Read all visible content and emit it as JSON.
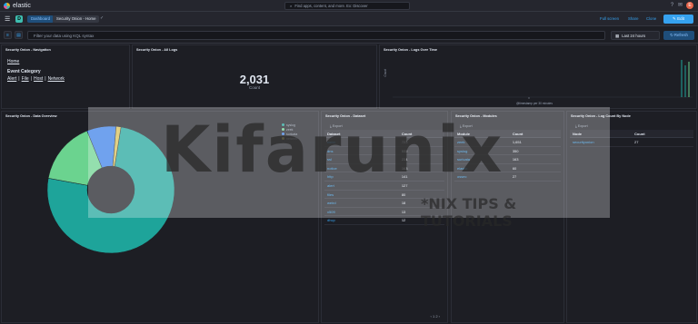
{
  "topbar": {
    "logo_text": "elastic",
    "search_placeholder": "Find apps, content, and more. Ex: Discover",
    "avatar_initial": "E"
  },
  "navbar": {
    "space_initial": "D",
    "breadcrumbs": [
      "Dashboard",
      "Security Onion - Home"
    ],
    "links": [
      "Full screen",
      "Share",
      "Clone"
    ],
    "edit_label": "Edit"
  },
  "querybar": {
    "placeholder": "Filter your data using KQL syntax",
    "date_label": "Last 24 hours",
    "refresh_label": "Refresh"
  },
  "panels": {
    "navigation": {
      "title": "Security Onion - Navigation",
      "home": "Home",
      "heading": "Event Category",
      "links": [
        "Alert",
        "File",
        "Host",
        "Network"
      ]
    },
    "all_logs": {
      "title": "Security Onion - All Logs",
      "value": "2,031",
      "label": "Count"
    },
    "logs_over_time": {
      "title": "Security Onion - Logs Over Time",
      "ylabel": "Count",
      "xlabel": "@timestamp per 30 minutes"
    },
    "data_overview": {
      "title": "Security Onion - Data Overview",
      "legend": [
        "syslog",
        "zeek",
        "suricata",
        "network"
      ]
    },
    "dataset": {
      "title": "Security Onion - Dataset",
      "export": "Export",
      "columns": [
        "Dataset",
        "Count"
      ],
      "rows": [
        [
          "conn",
          "723"
        ],
        [
          "dns",
          "532"
        ],
        [
          "ssl",
          "234"
        ],
        [
          "notice",
          "163"
        ],
        [
          "http",
          "141"
        ],
        [
          "alert",
          "127"
        ],
        [
          "files",
          "80"
        ],
        [
          "weird",
          "18"
        ],
        [
          "x509",
          "13"
        ],
        [
          "dhcp",
          "12"
        ]
      ]
    },
    "modules": {
      "title": "Security Onion - Modules",
      "export": "Export",
      "columns": [
        "Module",
        "Count"
      ],
      "rows": [
        [
          "zeek",
          "1,651"
        ],
        [
          "syslog",
          "350"
        ],
        [
          "suricata",
          "163"
        ],
        [
          "elastic",
          "60"
        ],
        [
          "ossec",
          "27"
        ]
      ]
    },
    "by_node": {
      "title": "Security Onion - Log Count By Node",
      "export": "Export",
      "columns": [
        "Node",
        "Count"
      ],
      "rows": [
        [
          "securityonion",
          "27"
        ]
      ]
    }
  },
  "chart_data": {
    "type": "pie",
    "categories": [
      "zeek",
      "syslog",
      "suricata",
      "network"
    ],
    "values": [
      1651,
      350,
      163,
      27
    ],
    "colors": [
      "#1ea49a",
      "#6bd38f",
      "#3a7ee8",
      "#d6bf57"
    ]
  },
  "watermark": {
    "main": "Kifarunix",
    "sub": "*NIX TIPS & TUTORIALS"
  },
  "colors": {
    "background": "#1d1e24",
    "accent": "#36a2ef",
    "teal": "#3ebeb0"
  }
}
